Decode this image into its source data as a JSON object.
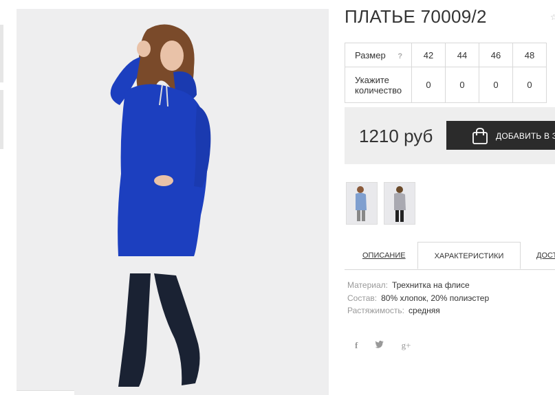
{
  "product": {
    "title": "ПЛАТЬЕ 70009/2"
  },
  "size_table": {
    "size_label": "Размер",
    "help_icon": "?",
    "sizes": [
      "42",
      "44",
      "46",
      "48"
    ],
    "qty_label": "Укажите количество",
    "quantities": [
      "0",
      "0",
      "0",
      "0"
    ]
  },
  "price": {
    "value": "1210 руб",
    "cart_button": "ДОБАВИТЬ В ЗА"
  },
  "tabs": {
    "description": "ОПИСАНИЕ",
    "characteristics": "ХАРАКТЕРИСТИКИ",
    "delivery": "ДОСТ"
  },
  "characteristics": [
    {
      "key": "Материал:",
      "value": "Трехнитка на флисе"
    },
    {
      "key": "Состав:",
      "value": "80% хлопок, 20% полиэстер"
    },
    {
      "key": "Растяжимость:",
      "value": "средняя"
    }
  ],
  "social": {
    "facebook": "f",
    "twitter": "twitter-icon",
    "gplus": "g+"
  },
  "colors": {
    "dress": "#1c3fbf",
    "boots": "#1a2233",
    "button": "#2b2b2b"
  }
}
